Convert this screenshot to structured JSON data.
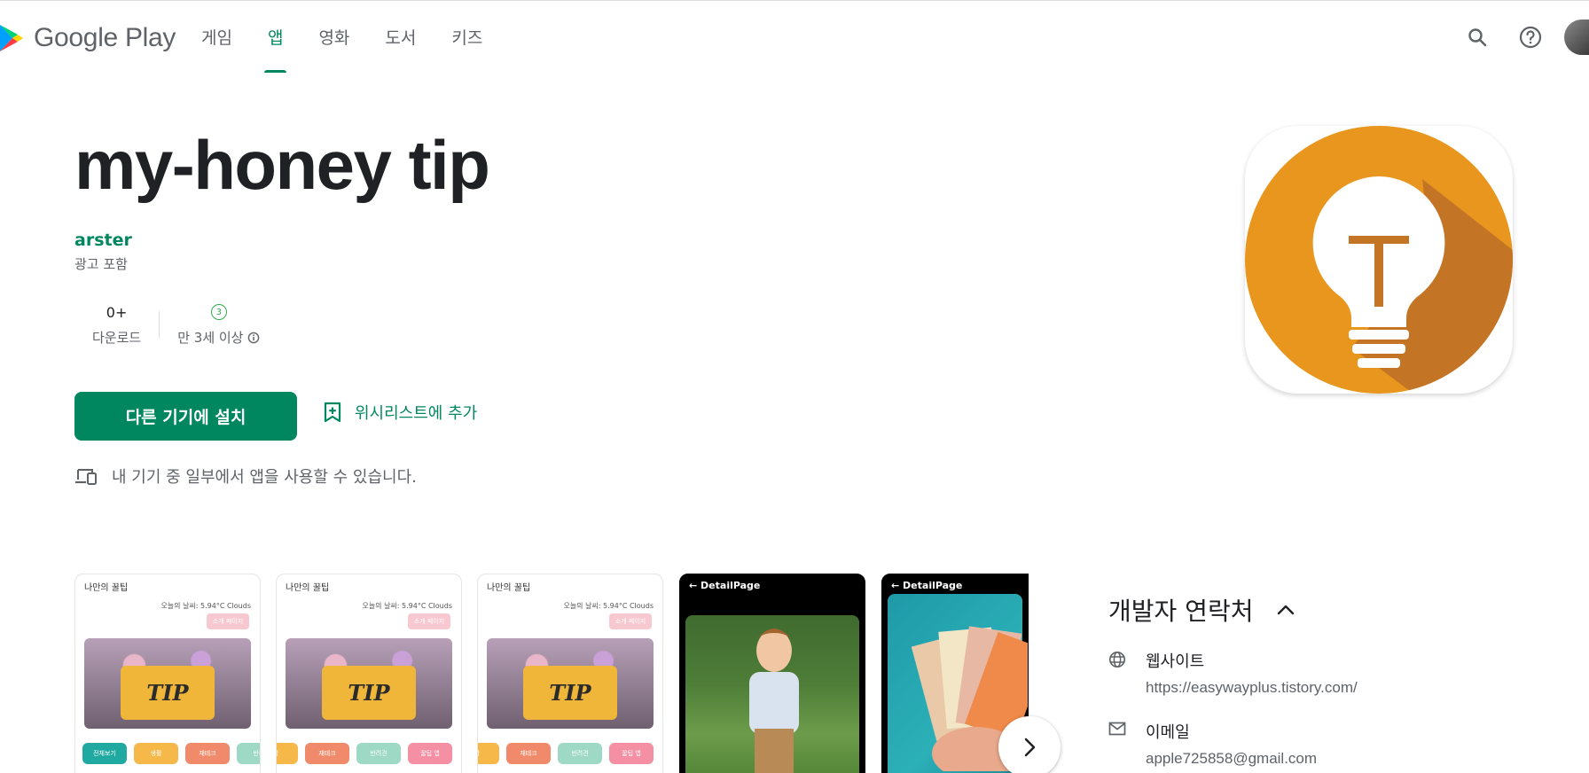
{
  "brand": {
    "name": "Google Play"
  },
  "nav": {
    "items": [
      {
        "label": "게임",
        "active": false
      },
      {
        "label": "앱",
        "active": true
      },
      {
        "label": "영화",
        "active": false
      },
      {
        "label": "도서",
        "active": false
      },
      {
        "label": "키즈",
        "active": false
      }
    ]
  },
  "header": {
    "icons": [
      "search-icon",
      "help-icon",
      "account-avatar"
    ]
  },
  "app": {
    "title": "my-honey tip",
    "developer": "arster",
    "ads_note": "광고 포함",
    "downloads_value": "0+",
    "downloads_label": "다운로드",
    "rating_badge": "3",
    "rating_label": "만 3세 이상",
    "install_label": "다른 기기에 설치",
    "wishlist_label": "위시리스트에 추가",
    "devices_note": "내 기기 중 일부에서 앱을 사용할 수 있습니다."
  },
  "colors": {
    "accent": "#01875f",
    "icon_orange": "#E8961E",
    "icon_shadow": "#C47425"
  },
  "screenshots": [
    {
      "type": "list",
      "title": "나만의 꿀팁",
      "weather": "오늘의 날씨: 5.94°C  Clouds",
      "button": "소개 페이지",
      "jar_text": "TIP",
      "chips": [
        "전체보기",
        "생활",
        "재테크",
        "반려"
      ]
    },
    {
      "type": "list",
      "title": "나만의 꿀팁",
      "weather": "오늘의 날씨: 5.94°C  Clouds",
      "button": "소개 페이지",
      "jar_text": "TIP",
      "chips": [
        "활",
        "재테크",
        "반려견",
        "꿀팁 앱"
      ]
    },
    {
      "type": "list",
      "title": "나만의 꿀팁",
      "weather": "오늘의 날씨: 5.94°C  Clouds",
      "button": "소개 페이지",
      "jar_text": "TIP",
      "chips": [
        "활",
        "재테크",
        "반려견",
        "꿀팁 앱"
      ]
    },
    {
      "type": "detail",
      "title": "DetailPage"
    },
    {
      "type": "detail",
      "title": "DetailPage"
    }
  ],
  "developer_contact": {
    "heading": "개발자 연락처",
    "website_label": "웹사이트",
    "website_value": "https://easywayplus.tistory.com/",
    "email_label": "이메일",
    "email_value": "apple725858@gmail.com"
  }
}
